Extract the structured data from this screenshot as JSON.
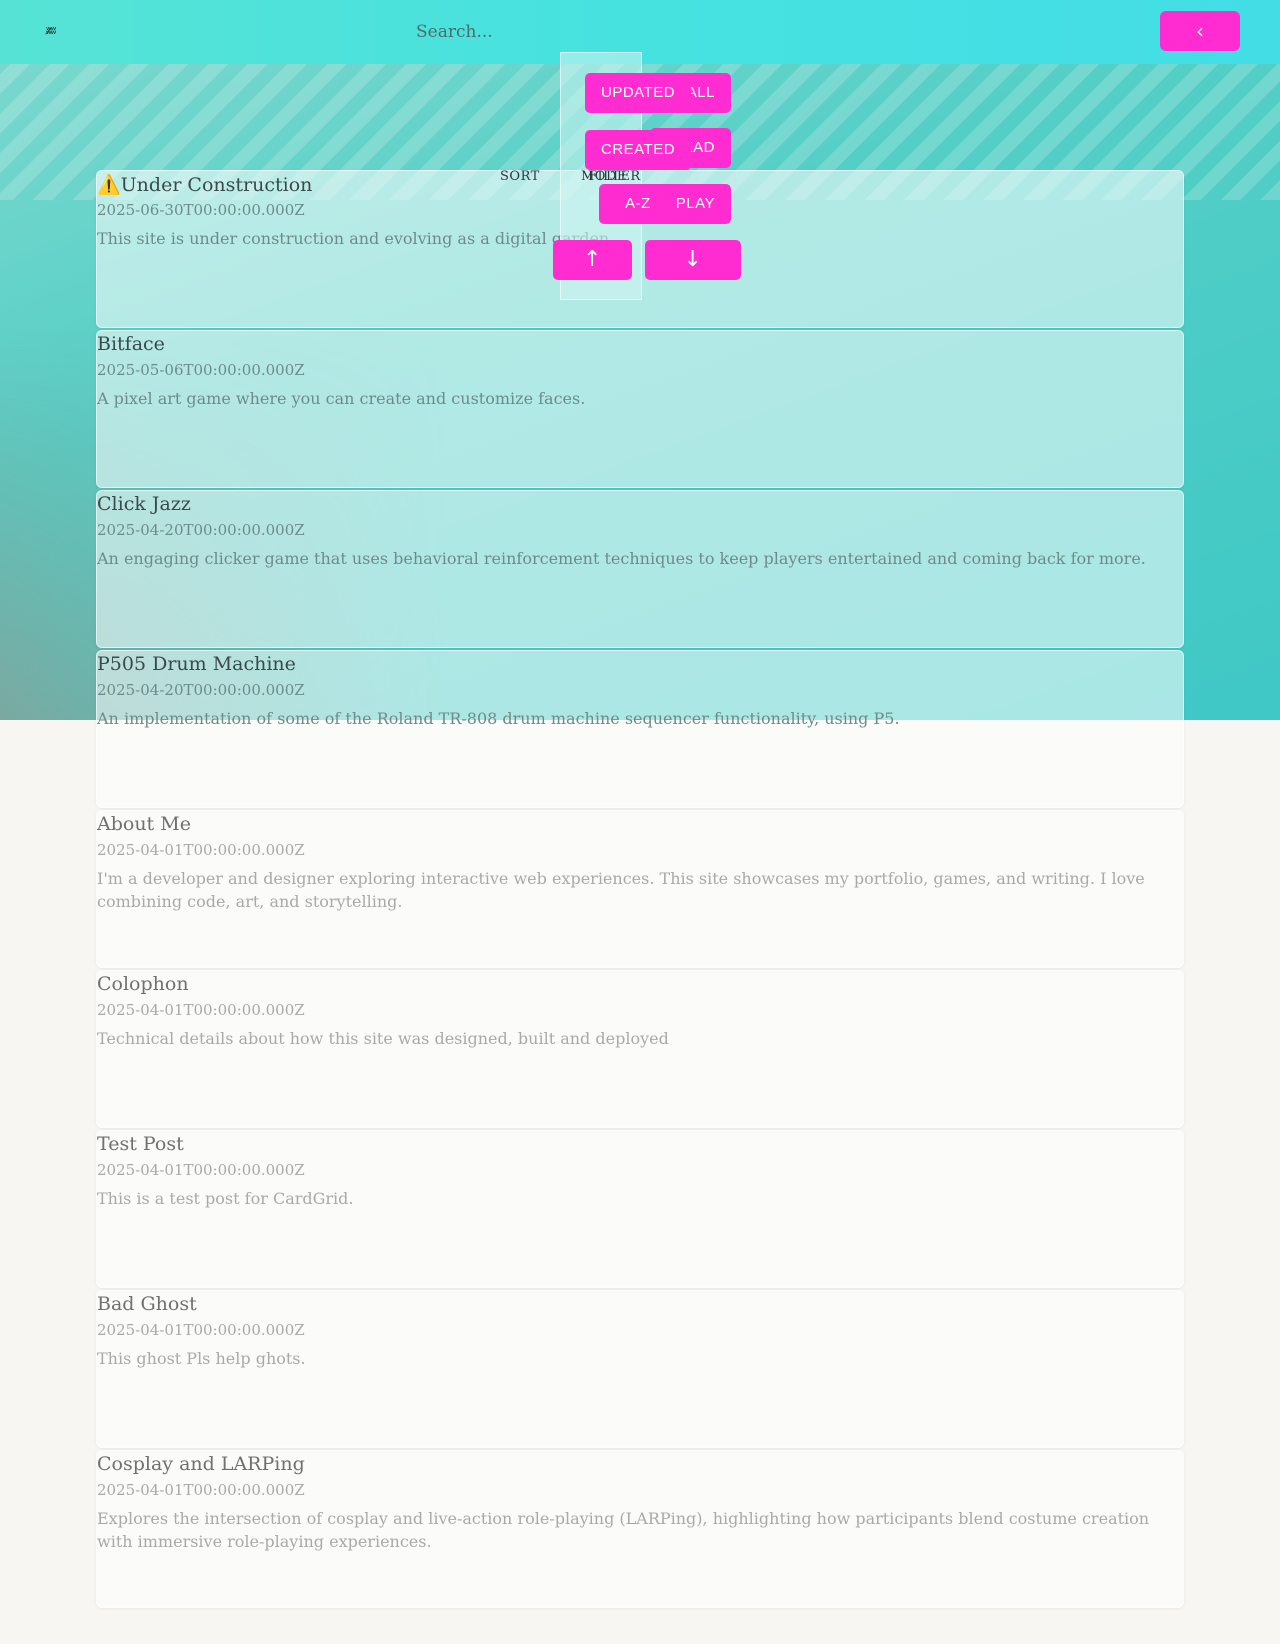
{
  "header": {
    "logo_text": "ʬ̷ʬ",
    "search_placeholder": "Search...",
    "back_label": "‹"
  },
  "controls": {
    "sort_label": "SORT",
    "mode_label": "MODE",
    "filter_label": "FILTER",
    "sort_buttons": [
      "UPDATED",
      "CREATED",
      "A-Z"
    ],
    "mode_buttons": [
      "ALL",
      "READ",
      "PLAY"
    ],
    "asc_label": "↑",
    "desc_label": "↓"
  },
  "cards": [
    {
      "title": "⚠️Under Construction",
      "date": "2025-06-30T00:00:00.000Z",
      "description": "This site is under construction and evolving as a digital garden."
    },
    {
      "title": "Bitface",
      "date": "2025-05-06T00:00:00.000Z",
      "description": "A pixel art game where you can create and customize faces."
    },
    {
      "title": "Click Jazz",
      "date": "2025-04-20T00:00:00.000Z",
      "description": "An engaging clicker game that uses behavioral reinforcement techniques to keep players entertained and coming back for more."
    },
    {
      "title": "P505 Drum Machine",
      "date": "2025-04-20T00:00:00.000Z",
      "description": "An implementation of some of the Roland TR-808 drum machine sequencer functionality, using P5."
    },
    {
      "title": "About Me",
      "date": "2025-04-01T00:00:00.000Z",
      "description": "I'm a developer and designer exploring interactive web experiences. This site showcases my portfolio, games, and writing. I love combining code, art, and storytelling."
    },
    {
      "title": "Colophon",
      "date": "2025-04-01T00:00:00.000Z",
      "description": "Technical details about how this site was designed, built and deployed"
    },
    {
      "title": "Test Post",
      "date": "2025-04-01T00:00:00.000Z",
      "description": "This is a test post for CardGrid."
    },
    {
      "title": "Bad Ghost",
      "date": "2025-04-01T00:00:00.000Z",
      "description": "This ghost Pls help ghots."
    },
    {
      "title": "Cosplay and LARPing",
      "date": "2025-04-01T00:00:00.000Z",
      "description": "Explores the intersection of cosplay and live-action role-playing (LARPing), highlighting how participants blend costume creation with immersive role-playing experiences."
    }
  ],
  "colors": {
    "accent": "#ff2cd2",
    "header": "#46e2e0",
    "hero": "#54cfc6",
    "warning_title": "#b36a5e"
  }
}
